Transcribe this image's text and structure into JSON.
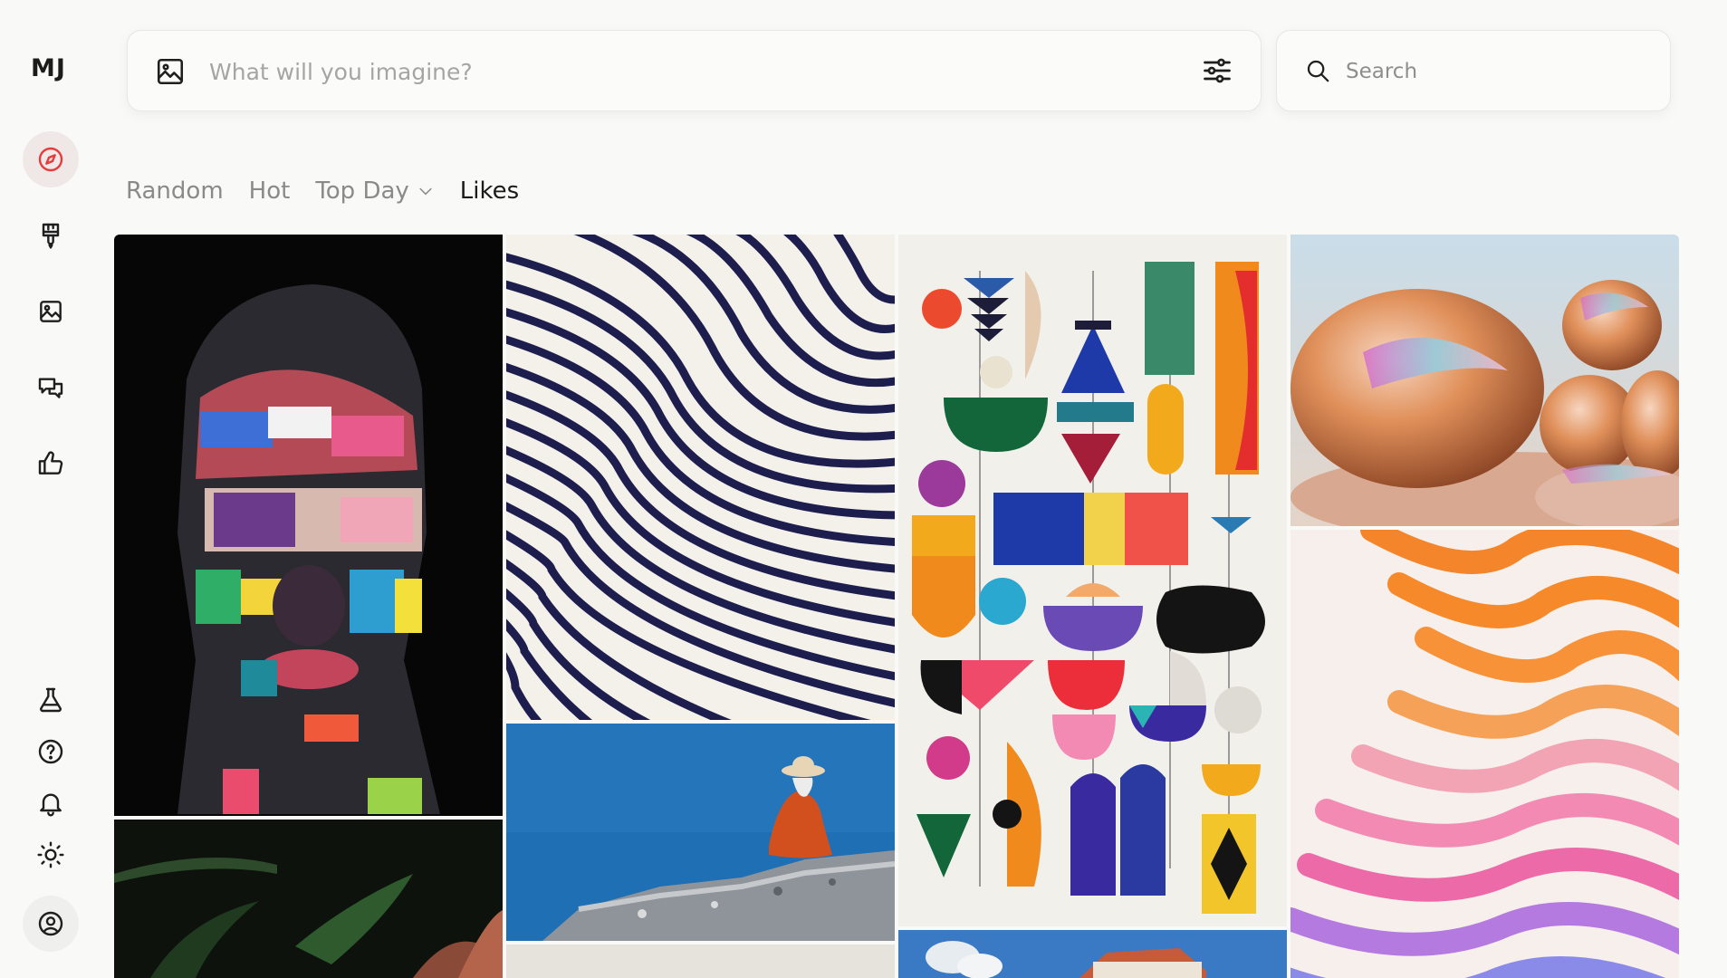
{
  "app": {
    "logo": "MJ"
  },
  "sidebar": {
    "items": [
      {
        "icon": "compass-icon",
        "active": true
      },
      {
        "icon": "brush-icon",
        "active": false
      },
      {
        "icon": "image-icon",
        "active": false
      },
      {
        "icon": "chat-icon",
        "active": false
      },
      {
        "icon": "thumbs-up-icon",
        "active": false
      },
      {
        "icon": "flask-icon",
        "active": false
      },
      {
        "icon": "help-icon",
        "active": false
      },
      {
        "icon": "bell-icon",
        "active": false
      },
      {
        "icon": "sun-icon",
        "active": false
      },
      {
        "icon": "user-icon",
        "active": false
      }
    ],
    "accent": "#e53d3f"
  },
  "prompt": {
    "placeholder": "What will you imagine?"
  },
  "search": {
    "placeholder": "Search"
  },
  "tabs": [
    {
      "label": "Random",
      "active": false
    },
    {
      "label": "Hot",
      "active": false
    },
    {
      "label": "Top Day",
      "active": false,
      "dropdown": true
    },
    {
      "label": "Likes",
      "active": true
    }
  ],
  "gallery": {
    "images": [
      {
        "subject": "painted-face-portrait"
      },
      {
        "subject": "dark-foliage"
      },
      {
        "subject": "navy-wavy-lines"
      },
      {
        "subject": "monk-on-rock"
      },
      {
        "subject": "ground-partial"
      },
      {
        "subject": "geometric-shapes"
      },
      {
        "subject": "house-painting"
      },
      {
        "subject": "iridescent-pebbles"
      },
      {
        "subject": "orange-pink-waves"
      }
    ]
  }
}
